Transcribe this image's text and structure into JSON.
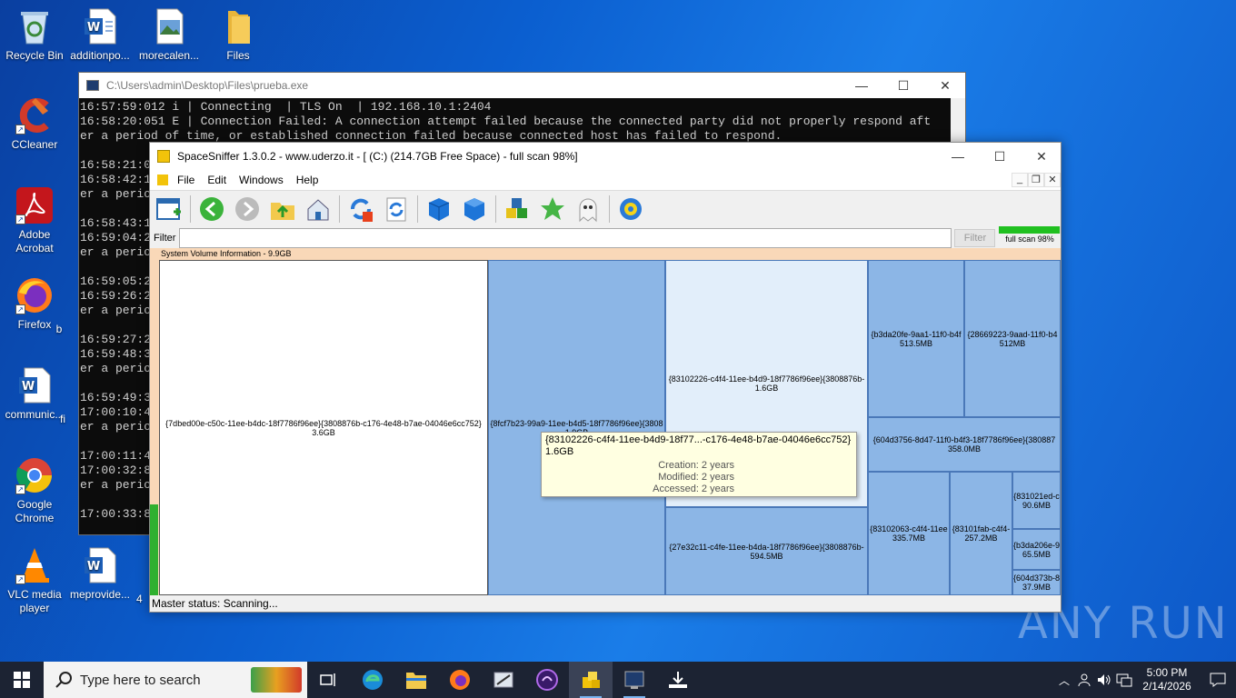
{
  "desktop": {
    "icons": [
      {
        "label": "Recycle Bin",
        "icon": "recycle-bin-icon"
      },
      {
        "label": "additionpo...",
        "icon": "word-doc-icon"
      },
      {
        "label": "morecalen...",
        "icon": "image-file-icon"
      },
      {
        "label": "Files",
        "icon": "folder-icon"
      },
      {
        "label": "CCleaner",
        "icon": "ccleaner-icon"
      },
      {
        "label": "Adobe Acrobat",
        "icon": "acrobat-icon"
      },
      {
        "label": "Firefox",
        "icon": "firefox-icon"
      },
      {
        "label": "communic...",
        "icon": "word-doc-icon"
      },
      {
        "label": "Google Chrome",
        "icon": "chrome-icon"
      },
      {
        "label": "VLC media player",
        "icon": "vlc-icon"
      },
      {
        "label": "meprovide...",
        "icon": "word-doc-icon"
      }
    ],
    "partial_labels": [
      "b",
      "fi",
      "4"
    ],
    "watermark": "ANY RUN"
  },
  "console": {
    "title": "C:\\Users\\admin\\Desktop\\Files\\prueba.exe",
    "lines": [
      "16:57:59:012 i | Connecting  | TLS On  | 192.168.10.1:2404",
      "16:58:20:051 E | Connection Failed: A connection attempt failed because the connected party did not properly respond aft",
      "er a period of time, or established connection failed because connected host has failed to respond.",
      "",
      "16:58:21:0",
      "16:58:42:1",
      "er a perio",
      "",
      "16:58:43:1",
      "16:59:04:2",
      "er a perio",
      "",
      "16:59:05:2",
      "16:59:26:2",
      "er a perio",
      "",
      "16:59:27:2",
      "16:59:48:3",
      "er a perio",
      "",
      "16:59:49:3",
      "17:00:10:4",
      "er a perio",
      "",
      "17:00:11:4",
      "17:00:32:8",
      "er a perio",
      "",
      "17:00:33:8"
    ]
  },
  "spacesniffer": {
    "title": "SpaceSniffer 1.3.0.2 - www.uderzo.it - [ (C:) (214.7GB Free Space) - full scan 98%]",
    "menu": [
      "File",
      "Edit",
      "Windows",
      "Help"
    ],
    "filter_label": "Filter",
    "filter_value": "",
    "filter_button": "Filter",
    "progress_label": "full scan 98%",
    "progress": 0.98,
    "header": "System Volume Information - 9.9GB",
    "blocks": [
      {
        "name": "{7dbed00e-c50c-11ee-b4dc-18f7786f96ee}{3808876b-c176-4e48-b7ae-04046e6cc752}",
        "size": "3.6GB"
      },
      {
        "name": "{8fcf7b23-99a9-11ee-b4d5-18f7786f96ee}{3808",
        "size": "1.9GB"
      },
      {
        "name": "{83102226-c4f4-11ee-b4d9-18f7786f96ee}{3808876b-",
        "size": "1.6GB"
      },
      {
        "name": "{27e32c11-c4fe-11ee-b4da-18f7786f96ee}{3808876b-",
        "size": "594.5MB"
      },
      {
        "name": "{b3da20fe-9aa1-11f0-b4f",
        "size": "513.5MB"
      },
      {
        "name": "{28669223-9aad-11f0-b4",
        "size": "512MB"
      },
      {
        "name": "{604d3756-8d47-11f0-b4f3-18f7786f96ee}{380887",
        "size": "358.0MB"
      },
      {
        "name": "{83102063-c4f4-11ee",
        "size": "335.7MB"
      },
      {
        "name": "{83101fab-c4f4-",
        "size": "257.2MB"
      },
      {
        "name": "{831021ed-c",
        "size": "90.6MB"
      },
      {
        "name": "{b3da206e-9",
        "size": "65.5MB"
      },
      {
        "name": "{604d373b-8",
        "size": "37.9MB"
      }
    ],
    "tooltip": {
      "name": "{83102226-c4f4-11ee-b4d9-18f77...-c176-4e48-b7ae-04046e6cc752}",
      "size": "1.6GB",
      "creation": "Creation: 2 years",
      "modified": "Modified: 2 years",
      "accessed": "Accessed: 2 years"
    },
    "status": "Master status: Scanning..."
  },
  "taskbar": {
    "search_placeholder": "Type here to search",
    "time": "5:00 PM",
    "date": "2/14/2026"
  }
}
